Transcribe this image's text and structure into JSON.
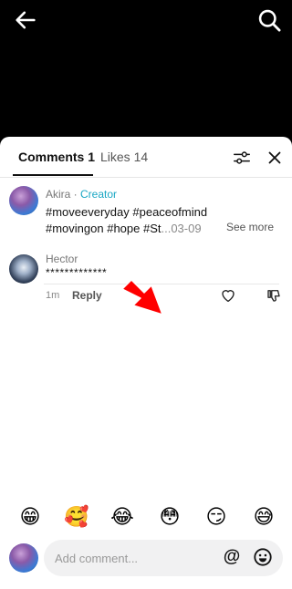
{
  "tabs": {
    "comments_label": "Comments 1",
    "likes_label": "Likes 14"
  },
  "caption": {
    "username": "Akira",
    "separator": " · ",
    "creator_badge": "Creator",
    "text": "#moveeveryday #peaceofmind #movingon #hope #St",
    "date": "...03-09",
    "see_more": "See more"
  },
  "comment": {
    "username": "Hector",
    "text": "*************",
    "time": "1m",
    "reply_label": "Reply"
  },
  "emojis": [
    "😁",
    "🥰",
    "😂",
    "😳",
    "😏",
    "😅"
  ],
  "composer": {
    "placeholder": "Add comment...",
    "mention": "@"
  },
  "icons": {
    "back": "back-arrow-icon",
    "search": "search-icon",
    "filter": "filter-sliders-icon",
    "close": "close-icon",
    "like": "heart-icon",
    "dislike": "thumbs-down-icon",
    "emoji_picker": "smiley-icon",
    "annotation": "red-arrow-icon"
  },
  "colors": {
    "creator": "#1aa7c4",
    "arrow": "#ff0000"
  }
}
